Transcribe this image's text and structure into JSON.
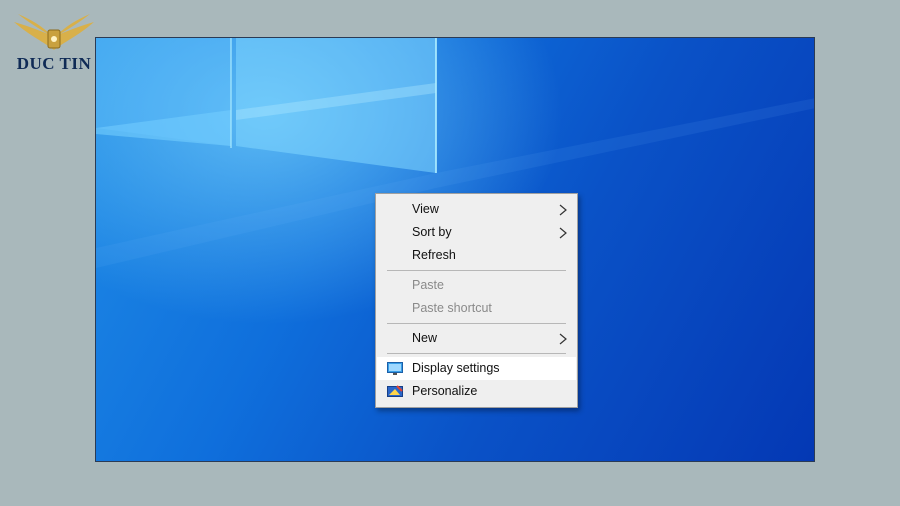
{
  "brand": {
    "name": "DUC TIN"
  },
  "context_menu": {
    "items": [
      {
        "label": "View",
        "has_submenu": true
      },
      {
        "label": "Sort by",
        "has_submenu": true
      },
      {
        "label": "Refresh"
      },
      {
        "label": "Paste",
        "disabled": true
      },
      {
        "label": "Paste shortcut",
        "disabled": true
      },
      {
        "label": "New",
        "has_submenu": true
      },
      {
        "label": "Display settings",
        "icon": "display-icon",
        "highlighted": true
      },
      {
        "label": "Personalize",
        "icon": "personalize-icon"
      }
    ]
  },
  "colors": {
    "desktop_blue": "#0a52c7",
    "menu_background": "#efefef",
    "brand_navy": "#0f2a55",
    "brand_gold": "#d8b04a"
  }
}
